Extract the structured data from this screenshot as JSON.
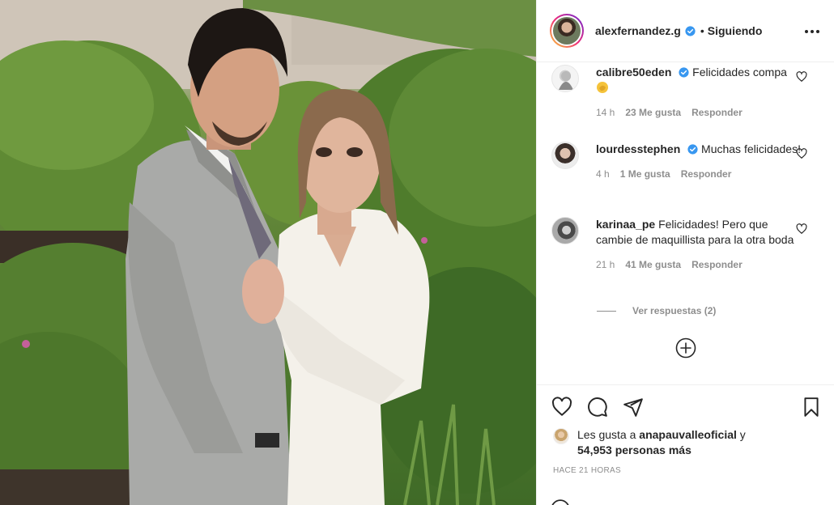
{
  "post": {
    "username": "alexfernandez.g",
    "separator": "•",
    "follow_status": "Siguiendo",
    "more_icon": "more-horizontal-icon"
  },
  "comments": [
    {
      "user": "calibre50eden",
      "verified": true,
      "text": "Felicidades compa",
      "emoji": "clapping-hand-emoji",
      "time": "14 h",
      "likes": "23 Me gusta",
      "reply": "Responder"
    },
    {
      "user": "lourdesstephen",
      "verified": true,
      "text": "Muchas felicidades!",
      "time": "4 h",
      "likes": "1 Me gusta",
      "reply": "Responder"
    },
    {
      "user": "karinaa_pe",
      "verified": false,
      "text": "Felicidades! Pero que cambie de maquillista para la otra boda",
      "time": "21 h",
      "likes": "41 Me gusta",
      "reply": "Responder"
    }
  ],
  "view_replies": "Ver respuestas (2)",
  "likes_summary": {
    "prefix": "Les gusta a",
    "user": "anapauvalleoficial",
    "connector": "y",
    "others": "54,953 personas más"
  },
  "time_ago": "HACE 21 HORAS",
  "colors": {
    "text": "#262626",
    "muted": "#8e8e8e",
    "verified": "#3897f0",
    "border": "#efefef"
  }
}
